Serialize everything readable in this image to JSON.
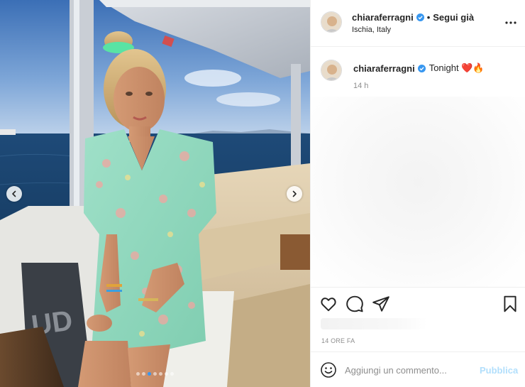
{
  "post": {
    "user": {
      "username": "chiaraferragni",
      "verified_icon": "verified-badge-icon",
      "separator": "•",
      "follow_label": "Segui già",
      "location": "Ischia, Italy"
    },
    "more_icon": "more-options-icon",
    "caption": {
      "username": "chiaraferragni",
      "text": "Tonight ❤️🔥",
      "time": "14 h"
    },
    "media": {
      "prev_icon": "chevron-left-icon",
      "next_icon": "chevron-right-icon",
      "carousel_count": 7,
      "carousel_active": 3
    },
    "actions": {
      "like_icon": "heart-icon",
      "comment_icon": "comment-icon",
      "share_icon": "send-icon",
      "save_icon": "bookmark-icon"
    },
    "timestamp": "14 ORE FA",
    "comment_box": {
      "emoji_icon": "smiley-icon",
      "placeholder": "Aggiungi un commento...",
      "publish_label": "Pubblica"
    }
  },
  "colors": {
    "verified": "#3897f0",
    "publish_disabled": "#b2dffc",
    "secondary_text": "#8e8e8e",
    "primary_text": "#262626",
    "border": "#efefef",
    "active_dot": "#3897f0"
  }
}
